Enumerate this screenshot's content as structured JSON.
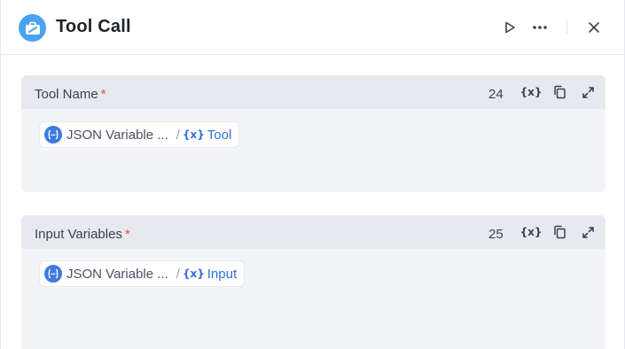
{
  "header": {
    "title": "Tool Call",
    "icon": "toolbox-icon",
    "accent": "#4aa3f0",
    "actions": [
      "play-icon",
      "more-icon",
      "close-icon"
    ]
  },
  "fields": [
    {
      "label": "Tool Name",
      "required_mark": "*",
      "count": "24",
      "var_button": "{x}",
      "chip": {
        "source": "JSON Variable ...",
        "separator": "/",
        "var_icon": "{x}",
        "variable": "Tool"
      }
    },
    {
      "label": "Input Variables",
      "required_mark": "*",
      "count": "25",
      "var_button": "{x}",
      "chip": {
        "source": "JSON Variable ...",
        "separator": "/",
        "var_icon": "{x}",
        "variable": "Input"
      }
    }
  ]
}
